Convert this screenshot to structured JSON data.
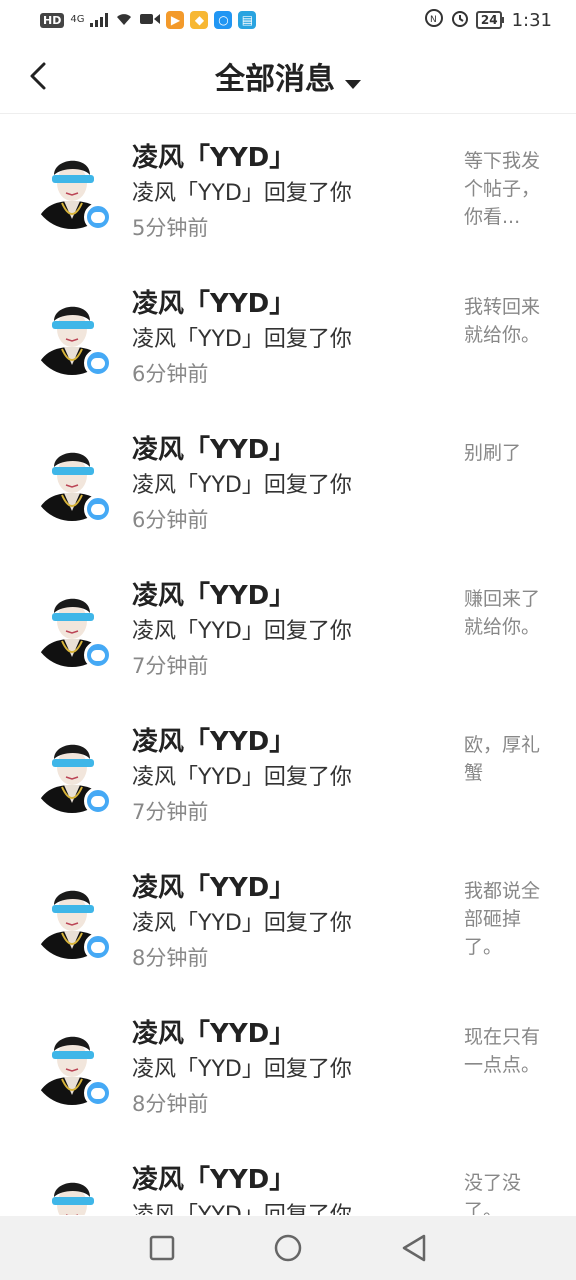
{
  "status_bar": {
    "hd": "HD",
    "network": "4G",
    "time": "1:31",
    "battery": "24"
  },
  "header": {
    "title": "全部消息"
  },
  "messages": [
    {
      "name": "凌风「YYD」",
      "action": "凌风「YYD」回复了你",
      "time": "5分钟前",
      "preview": "等下我发个帖子，你看..."
    },
    {
      "name": "凌风「YYD」",
      "action": "凌风「YYD」回复了你",
      "time": "6分钟前",
      "preview": "我转回来就给你。"
    },
    {
      "name": "凌风「YYD」",
      "action": "凌风「YYD」回复了你",
      "time": "6分钟前",
      "preview": "别刷了"
    },
    {
      "name": "凌风「YYD」",
      "action": "凌风「YYD」回复了你",
      "time": "7分钟前",
      "preview": "赚回来了就给你。"
    },
    {
      "name": "凌风「YYD」",
      "action": "凌风「YYD」回复了你",
      "time": "7分钟前",
      "preview": "欧，厚礼蟹"
    },
    {
      "name": "凌风「YYD」",
      "action": "凌风「YYD」回复了你",
      "time": "8分钟前",
      "preview": "我都说全部砸掉了。"
    },
    {
      "name": "凌风「YYD」",
      "action": "凌风「YYD」回复了你",
      "time": "8分钟前",
      "preview": "现在只有一点点。"
    },
    {
      "name": "凌风「YYD」",
      "action": "凌风「YYD」回复了你",
      "time": "",
      "preview": "没了没了。"
    }
  ]
}
